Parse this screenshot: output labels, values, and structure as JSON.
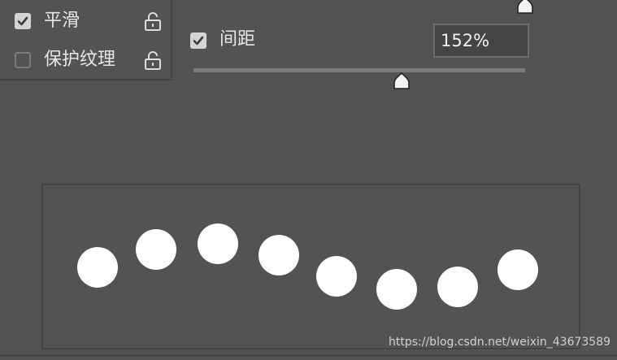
{
  "options": [
    {
      "label": "平滑",
      "checked": true,
      "icon": "lock-open-icon"
    },
    {
      "label": "保护纹理",
      "checked": false,
      "icon": "lock-open-icon"
    }
  ],
  "spacing": {
    "checkbox_checked": true,
    "label": "间距",
    "value": "152%",
    "slider_level": 0.628
  },
  "preview": {
    "dot_count": 8,
    "dot_color": "#ffffff"
  },
  "watermark": "https://blog.csdn.net/weixin_43673589",
  "colors": {
    "background": "#535353",
    "border": "#454545",
    "text": "#e6e6e6",
    "checkbox_fill": "#d4d4d4"
  }
}
